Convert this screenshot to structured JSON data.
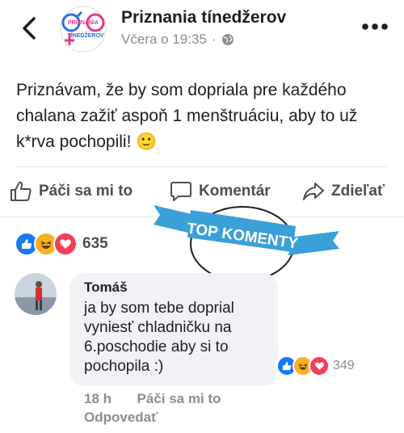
{
  "header": {
    "page_name": "Priznania tínedžerov",
    "time": "Včera o 19:35",
    "dot": "·",
    "logo_text": [
      "PRIZNANIA",
      "TÍNEDŽEROV"
    ]
  },
  "post": {
    "text": "Priznávam, že by som dopriala pre každého chalana zažiť aspoň 1  menštruáciu, aby to už k*rva pochopili! 🙂"
  },
  "actions": {
    "like": "Páči sa mi to",
    "comment": "Komentár",
    "share": "Zdieľať"
  },
  "banner": {
    "text": "TOP KOMENTY"
  },
  "reactions": {
    "count": "635",
    "types": [
      "like-icon",
      "haha-icon",
      "love-icon"
    ]
  },
  "comment": {
    "author": "Tomáš",
    "text": "ja by som tebe doprial vyniesť chladničku na 6.poschodie aby si to pochopila :)",
    "reaction_count": "349",
    "time": "18 h",
    "like": "Páči sa mi to",
    "reply": "Odpovedať"
  },
  "colors": {
    "fb_blue": "#1877f2",
    "haha_yellow": "#f7b125",
    "love_red": "#f33e58",
    "banner_blue": "#3aa0d8"
  }
}
